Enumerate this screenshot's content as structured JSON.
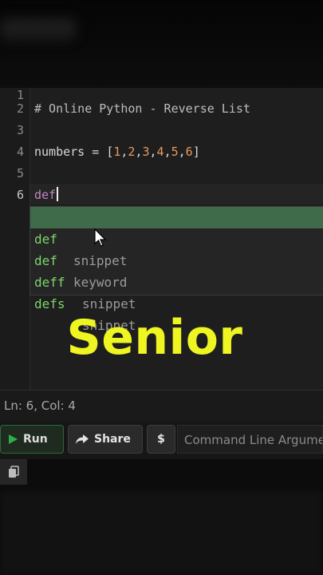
{
  "editor": {
    "lines": [
      {
        "no": "1",
        "text": ""
      },
      {
        "no": "2",
        "text": "# Online Python - Reverse List"
      },
      {
        "no": "3",
        "text": ""
      },
      {
        "no": "4",
        "text": "numbers = [1,2,3,4,5,6]"
      },
      {
        "no": "5",
        "text": ""
      },
      {
        "no": "6",
        "text": "def"
      }
    ],
    "line2": "# Online Python - Reverse List",
    "line4": {
      "var": "numbers",
      "op": " = ",
      "open": "[",
      "n1": "1",
      "n2": "2",
      "n3": "3",
      "n4": "4",
      "n5": "5",
      "n6": "6",
      "comma": ",",
      "close": "]"
    },
    "line6": "def"
  },
  "suggestions": [
    {
      "word": "def",
      "kind": "snippet",
      "selected": true
    },
    {
      "word": "def",
      "kind": "keyword",
      "selected": false
    },
    {
      "word": "deff",
      "kind": "snippet",
      "selected": false
    },
    {
      "word": "defs",
      "kind": "snippet",
      "selected": false
    }
  ],
  "overlay": {
    "title": "Senior"
  },
  "status": {
    "position": "Ln: 6,  Col: 4"
  },
  "toolbar": {
    "run_label": "Run",
    "share_label": "Share",
    "dollar_label": "$",
    "args_placeholder": "Command Line Arguments"
  },
  "icons": {
    "run": "play-icon",
    "share": "share-icon",
    "copy": "copy-icon",
    "mouse": "mouse-pointer-icon"
  },
  "colors": {
    "accent_title": "#eef521",
    "suggestion_selected": "#3f6b4b",
    "suggestion_text": "#7fd36a",
    "number": "#e69a5d",
    "keyword": "#c586c0",
    "run_green": "#2fae4a"
  }
}
